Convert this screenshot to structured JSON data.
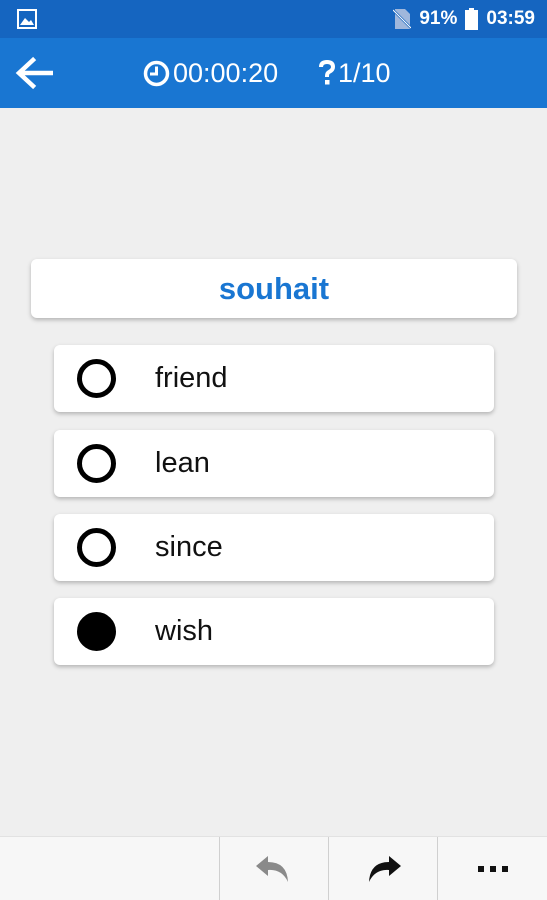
{
  "status_bar": {
    "battery_percent": "91%",
    "time": "03:59",
    "icons": [
      "image-icon",
      "no-sim-icon",
      "battery-icon"
    ]
  },
  "app_bar": {
    "timer": "00:00:20",
    "progress": "1/10",
    "icons": [
      "back-arrow-icon",
      "clock-icon",
      "question-mark-icon"
    ]
  },
  "quiz": {
    "word": "souhait",
    "options": [
      {
        "label": "friend",
        "selected": false
      },
      {
        "label": "lean",
        "selected": false
      },
      {
        "label": "since",
        "selected": false
      },
      {
        "label": "wish",
        "selected": true
      }
    ]
  },
  "bottom_bar": {
    "buttons": [
      "undo-icon",
      "redo-icon",
      "more-icon"
    ],
    "more_label": "..."
  },
  "colors": {
    "status_bar": "#1565c0",
    "app_bar": "#1976d2",
    "accent_text": "#1976d2",
    "background": "#efefef"
  }
}
